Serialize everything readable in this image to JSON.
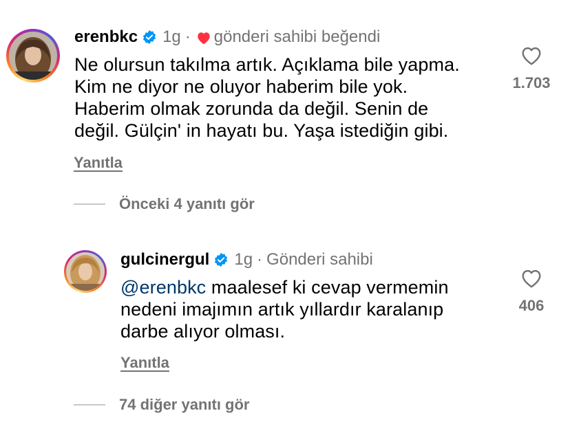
{
  "comments": [
    {
      "username": "erenbkc",
      "time": "1g",
      "liked_by_author": "gönderi sahibi beğendi",
      "lines": [
        "Ne olursun takılma artık.  Açıklama bile yapma.",
        "Kim ne diyor ne oluyor haberim bile yok.",
        "Haberim olmak zorunda da değil. Senin de",
        "değil. Gülçin' in hayatı bu. Yaşa istediğin gibi."
      ],
      "reply_label": "Yanıtla",
      "likes": "1.703",
      "view_replies": "Önceki 4 yanıtı gör"
    },
    {
      "username": "gulcinergul",
      "time": "1g",
      "badge": "Gönderi sahibi",
      "mention": "@erenbkc",
      "lines": [
        "maalesef ki cevap vermemin",
        "nedeni imajımın artık yıllardır karalanıp",
        "darbe alıyor olması."
      ],
      "reply_label": "Yanıtla",
      "likes": "406",
      "view_replies": "74 diğer yanıtı gör"
    }
  ],
  "colors": {
    "verified": "#0095f6",
    "liked_heart": "#ff3040",
    "secondary_text": "#737373",
    "mention": "#00376b"
  },
  "icons": [
    "verified-badge-icon",
    "heart-icon",
    "like-heart-outline-icon"
  ]
}
